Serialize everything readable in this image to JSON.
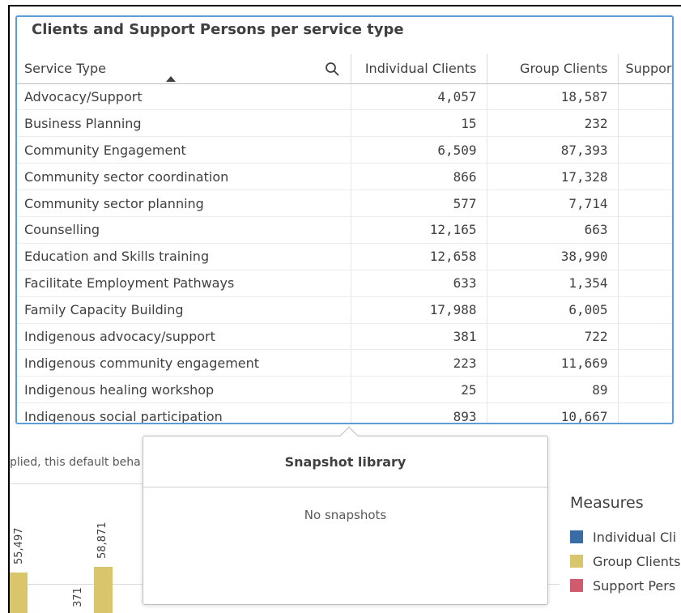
{
  "panel": {
    "title": "Clients and Support Persons per service type",
    "accent_color": "#5c9cd8"
  },
  "table": {
    "columns": [
      "Service Type",
      "Individual Clients",
      "Group Clients",
      "Suppor"
    ],
    "sort_indicator": "ascending",
    "rows": [
      {
        "service": "Advocacy/Support",
        "individual": "4,057",
        "group": "18,587"
      },
      {
        "service": "Business Planning",
        "individual": "15",
        "group": "232"
      },
      {
        "service": "Community Engagement",
        "individual": "6,509",
        "group": "87,393"
      },
      {
        "service": "Community sector coordination",
        "individual": "866",
        "group": "17,328"
      },
      {
        "service": "Community sector planning",
        "individual": "577",
        "group": "7,714"
      },
      {
        "service": "Counselling",
        "individual": "12,165",
        "group": "663"
      },
      {
        "service": "Education and Skills training",
        "individual": "12,658",
        "group": "38,990"
      },
      {
        "service": "Facilitate Employment Pathways",
        "individual": "633",
        "group": "1,354"
      },
      {
        "service": "Family Capacity Building",
        "individual": "17,988",
        "group": "6,005"
      },
      {
        "service": "Indigenous advocacy/support",
        "individual": "381",
        "group": "722"
      },
      {
        "service": "Indigenous community engagement",
        "individual": "223",
        "group": "11,669"
      },
      {
        "service": "Indigenous healing workshop",
        "individual": "25",
        "group": "89"
      },
      {
        "service": "Indigenous social participation",
        "individual": "893",
        "group": "10,667"
      }
    ]
  },
  "background": {
    "hint_text": "plied, this default beha",
    "bar_labels": [
      "55,497",
      "58,871",
      "371"
    ],
    "bar_color": "#d9c56b"
  },
  "legend": {
    "title": "Measures",
    "items": [
      {
        "label": "Individual Cli",
        "color": "#3a6da8"
      },
      {
        "label": "Group Clients",
        "color": "#d9c56b"
      },
      {
        "label": "Support Pers",
        "color": "#cf5b6d"
      }
    ]
  },
  "snapshot_library": {
    "title": "Snapshot library",
    "empty_text": "No snapshots"
  }
}
